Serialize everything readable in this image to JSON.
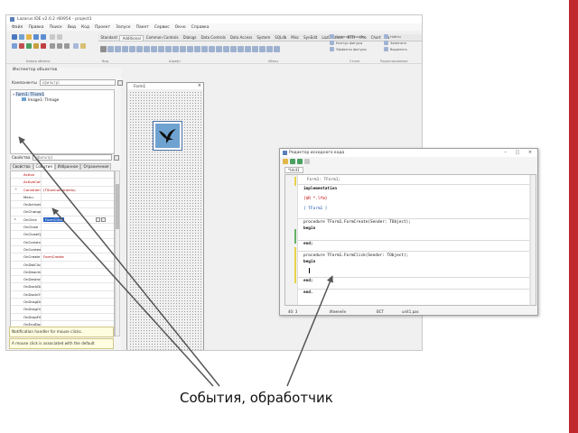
{
  "ide": {
    "title": "Lazarus IDE v2.0.2 r60954 - project1",
    "menu": [
      "Файл",
      "Правка",
      "Поиск",
      "Вид",
      "Код",
      "Проект",
      "Запуск",
      "Пакет",
      "Сервис",
      "Окно",
      "Справка"
    ],
    "palette_tabs": [
      "Standard",
      "Additional",
      "Common Controls",
      "Dialogs",
      "Data Controls",
      "Data Access",
      "System",
      "SQLdb",
      "Misc",
      "SynEdit",
      "LazControls",
      "RTTI",
      "IPro",
      "Chart",
      "Pa"
    ],
    "active_palette_tab": "Additional",
    "group_labels": [
      "Бефер обмена",
      "Вид",
      "Шрифт",
      "Абзац",
      "Стили",
      "Редактирование"
    ],
    "ribbon_right": [
      "Заменит фиолан",
      "Контур фигуры",
      "Эффекты фигуры",
      "Найти",
      "Заменить",
      "Выделить"
    ],
    "accent_color": "#c0282d"
  },
  "inspector": {
    "title": "Инспектор объектов",
    "components_label": "Компоненты",
    "filter_placeholder": "(фильтр)",
    "tree": [
      "Form1: TForm1",
      "Image1: TImage"
    ],
    "props_label": "Свойства",
    "tabs": [
      "Свойства",
      "События",
      "Избранное",
      "Ограничения"
    ],
    "active_tab": "События",
    "events": [
      {
        "name": "Action",
        "value": ""
      },
      {
        "name": "ActiveControl",
        "value": ""
      },
      {
        "name": "Constraints",
        "value": "(TSizeConstraints)"
      },
      {
        "name": "Menu",
        "value": ""
      },
      {
        "name": "OnActivate",
        "value": ""
      },
      {
        "name": "OnChangeBounds",
        "value": ""
      },
      {
        "name": "OnClick",
        "value": "FormClick"
      },
      {
        "name": "OnClose",
        "value": ""
      },
      {
        "name": "OnCloseQuery",
        "value": ""
      },
      {
        "name": "OnConstrainedResize",
        "value": ""
      },
      {
        "name": "OnContextPopup",
        "value": ""
      },
      {
        "name": "OnCreate",
        "value": "FormCreate"
      },
      {
        "name": "OnDblClick",
        "value": ""
      },
      {
        "name": "OnDeactivate",
        "value": ""
      },
      {
        "name": "OnDestroy",
        "value": ""
      },
      {
        "name": "OnDockDrop",
        "value": ""
      },
      {
        "name": "OnDockOver",
        "value": ""
      },
      {
        "name": "OnDragDrop",
        "value": ""
      },
      {
        "name": "OnDragOver",
        "value": ""
      },
      {
        "name": "OnDropFiles",
        "value": ""
      },
      {
        "name": "OnEndDock",
        "value": ""
      },
      {
        "name": "OnGetSiteInfo",
        "value": ""
      }
    ],
    "active_event": "OnClick",
    "hint1": "Notification handler for mouse clicks.",
    "hint2": "A mouse click is associated with the default"
  },
  "form1": {
    "title": "Form1",
    "close_glyph": "×",
    "image_icon": "bird-icon"
  },
  "editor": {
    "title": "Редактор исходного кода",
    "window_controls": "– □ ×",
    "tab": "*Unit1",
    "lines": [
      {
        "text": "Form1: TForm1;",
        "style": "ti"
      },
      {
        "text": "implementation",
        "style": "kw"
      },
      {
        "text": "{$R *.lfm}",
        "style": "dir"
      },
      {
        "text": "{ TForm1 }",
        "style": "cm"
      },
      {
        "text": "procedure TForm1.FormCreate(Sender: TObject);",
        "style": ""
      },
      {
        "text": "begin",
        "style": "kw"
      },
      {
        "text": "end;",
        "style": "kw"
      },
      {
        "text": "procedure TForm1.FormClick(Sender: TObject);",
        "style": ""
      },
      {
        "text": "begin",
        "style": "kw"
      },
      {
        "text": "end;",
        "style": "kw"
      },
      {
        "text": "end.",
        "style": "kw"
      }
    ],
    "status": {
      "pos": "40: 3",
      "state": "Изменён",
      "mode": "ВСТ",
      "file": "unit1.pas"
    }
  },
  "caption": "События, обработчик"
}
